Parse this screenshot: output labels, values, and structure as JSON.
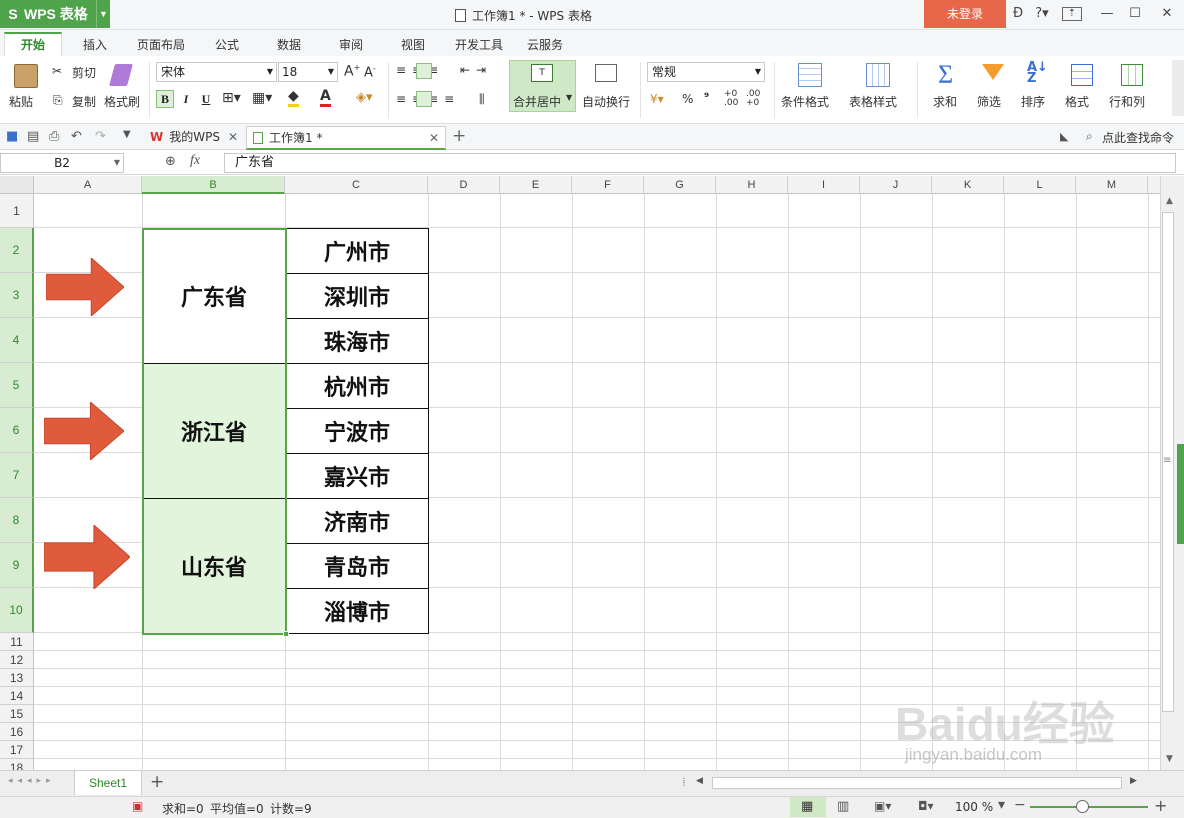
{
  "app": {
    "menu_label": "WPS 表格",
    "window_title": "工作簿1 * - WPS 表格",
    "login_label": "未登录"
  },
  "ribbon_tabs": [
    "开始",
    "插入",
    "页面布局",
    "公式",
    "数据",
    "审阅",
    "视图",
    "开发工具",
    "云服务"
  ],
  "ribbon": {
    "paste": "粘贴",
    "cut": "剪切",
    "copy": "复制",
    "format_painter": "格式刷",
    "font_name": "宋体",
    "font_size": "18",
    "bold": "B",
    "italic": "I",
    "underline": "U",
    "merge_center": "合并居中",
    "wrap_text": "自动换行",
    "number_format": "常规",
    "percent": "%",
    "comma": "⁹",
    "conditional_format": "条件格式",
    "table_style": "表格样式",
    "sum": "求和",
    "filter": "筛选",
    "sort": "排序",
    "format": "格式",
    "row_col": "行和列"
  },
  "doc_tabs": [
    {
      "label": "我的WPS"
    },
    {
      "label": "工作簿1 *"
    }
  ],
  "search_command": "点此查找命令",
  "formula_bar": {
    "name_box": "B2",
    "fx": "fx",
    "content": "广东省"
  },
  "columns": [
    "A",
    "B",
    "C",
    "D",
    "E",
    "F",
    "G",
    "H",
    "I",
    "J",
    "K",
    "L",
    "M"
  ],
  "rows": [
    "1",
    "2",
    "3",
    "4",
    "5",
    "6",
    "7",
    "8",
    "9",
    "10",
    "11",
    "12",
    "13",
    "14",
    "15",
    "16",
    "17",
    "18"
  ],
  "provinces": [
    "广东省",
    "浙江省",
    "山东省"
  ],
  "cities": [
    "广州市",
    "深圳市",
    "珠海市",
    "杭州市",
    "宁波市",
    "嘉兴市",
    "济南市",
    "青岛市",
    "淄博市"
  ],
  "sheet_tab": "Sheet1",
  "status": {
    "sum": "求和=0",
    "average": "平均值=0",
    "count": "计数=9",
    "zoom": "100 %"
  },
  "watermark": {
    "brand": "Baidu经验",
    "url": "jingyan.baidu.com"
  },
  "colors": {
    "accent": "#4fa34a",
    "login": "#e8674a",
    "arrow": "#e05a3c",
    "selection_fill": "#e2f4dc",
    "selection_border": "#5aa34a"
  }
}
